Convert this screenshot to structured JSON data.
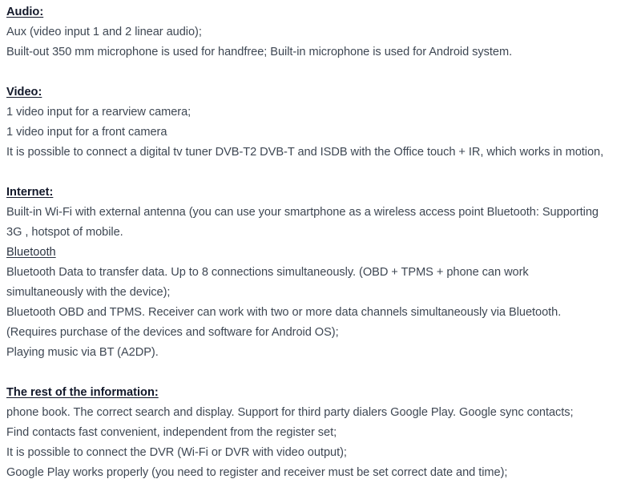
{
  "document": {
    "text_color": "#3e4753",
    "heading_color": "#12182a",
    "background_color": "#ffffff",
    "sections": [
      {
        "id": "audio",
        "heading": "Audio:",
        "heading_style": "bold-underline",
        "lines": [
          "Aux (video input 1 and 2 linear audio);",
          "Built-out 350 mm microphone is used for handfree; Built-in microphone is used for Android system."
        ]
      },
      {
        "id": "video",
        "heading": "Video:",
        "heading_style": "bold-underline",
        "lines": [
          "1 video input for a rearview camera;",
          "1 video input for a front camera",
          "It is possible to connect a digital tv tuner DVB-T2 DVB-T and ISDB with the Office touch + IR, which works in motion,"
        ]
      },
      {
        "id": "internet",
        "heading": "Internet:",
        "heading_style": "bold-underline",
        "lines": [
          "Built-in Wi-Fi with external antenna (you can use your smartphone as a wireless access point Bluetooth: Supporting",
          "3G , hotspot of mobile."
        ]
      },
      {
        "id": "bluetooth",
        "heading": "Bluetooth",
        "heading_style": "underline",
        "lines": [
          "Bluetooth Data to transfer data. Up to 8 connections simultaneously. (OBD + TPMS + phone can work",
          "simultaneously with the device);",
          "Bluetooth OBD and TPMS. Receiver can work with two or more data channels simultaneously via Bluetooth.",
          "(Requires purchase of the devices and software for Android OS);",
          "Playing music via BT (A2DP)."
        ]
      },
      {
        "id": "rest",
        "heading": "The rest of the information:",
        "heading_style": "bold-underline",
        "lines": [
          "phone book. The correct search and display. Support for third party dialers Google Play. Google sync contacts;",
          "Find contacts fast convenient, independent from the register set;",
          "It is possible to connect the DVR (Wi-Fi or DVR with video output);",
          "Google Play works properly (you need to register and receiver must be set correct date and time);"
        ]
      }
    ]
  }
}
